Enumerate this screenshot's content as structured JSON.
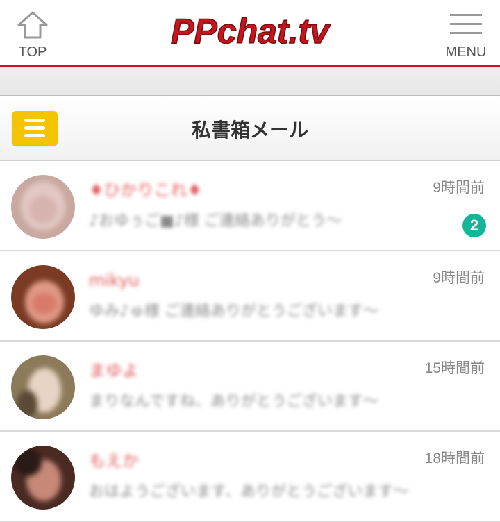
{
  "header": {
    "top_label": "TOP",
    "menu_label": "MENU",
    "logo_text": "PPchat.tv",
    "accent_color": "#c4161c"
  },
  "page": {
    "title": "私書箱メール",
    "menu_icon_color": "#f5c400"
  },
  "messages": [
    {
      "name": "♦ひかりこれ♦",
      "preview": "♪おゆぅご■♪様 ご連絡ありがとう〜",
      "time": "9時間前",
      "unread": "2"
    },
    {
      "name": "mikyu",
      "preview": "ゆみ♪ゅ様 ご連絡ありがとうございます〜",
      "time": "9時間前",
      "unread": ""
    },
    {
      "name": "まゆよ",
      "preview": "まりなんですね、ありがとうございます〜",
      "time": "15時間前",
      "unread": ""
    },
    {
      "name": "もえか",
      "preview": "おはようございます、ありがとうございます〜",
      "time": "18時間前",
      "unread": ""
    }
  ]
}
